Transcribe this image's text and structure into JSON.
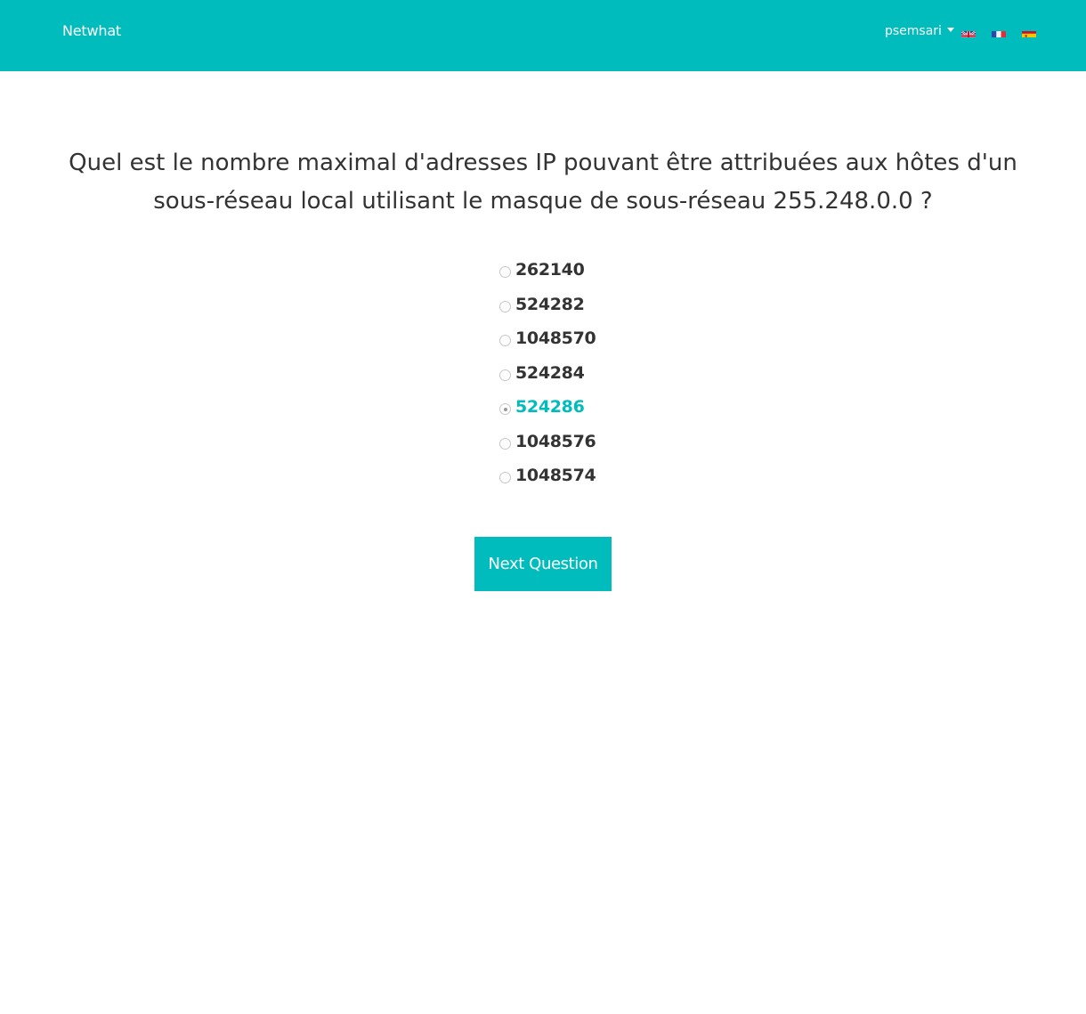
{
  "navbar": {
    "brand": "Netwhat",
    "user": "psemsari",
    "languages": [
      {
        "code": "en",
        "icon": "uk-flag-icon"
      },
      {
        "code": "fr",
        "icon": "france-flag-icon"
      },
      {
        "code": "es",
        "icon": "spain-flag-icon"
      }
    ],
    "background_color": "#00bcbd"
  },
  "quiz": {
    "question": "Quel est le nombre maximal d'adresses IP pouvant être attribuées aux hôtes d'un sous-réseau local utilisant le masque de sous-réseau 255.248.0.0 ?",
    "answers": [
      {
        "label": "262140",
        "selected": false
      },
      {
        "label": "524282",
        "selected": false
      },
      {
        "label": "1048570",
        "selected": false
      },
      {
        "label": "524284",
        "selected": false
      },
      {
        "label": "524286",
        "selected": true
      },
      {
        "label": "1048576",
        "selected": false
      },
      {
        "label": "1048574",
        "selected": false
      }
    ],
    "next_button": "Next Question",
    "accent_color": "#00bcbd"
  }
}
